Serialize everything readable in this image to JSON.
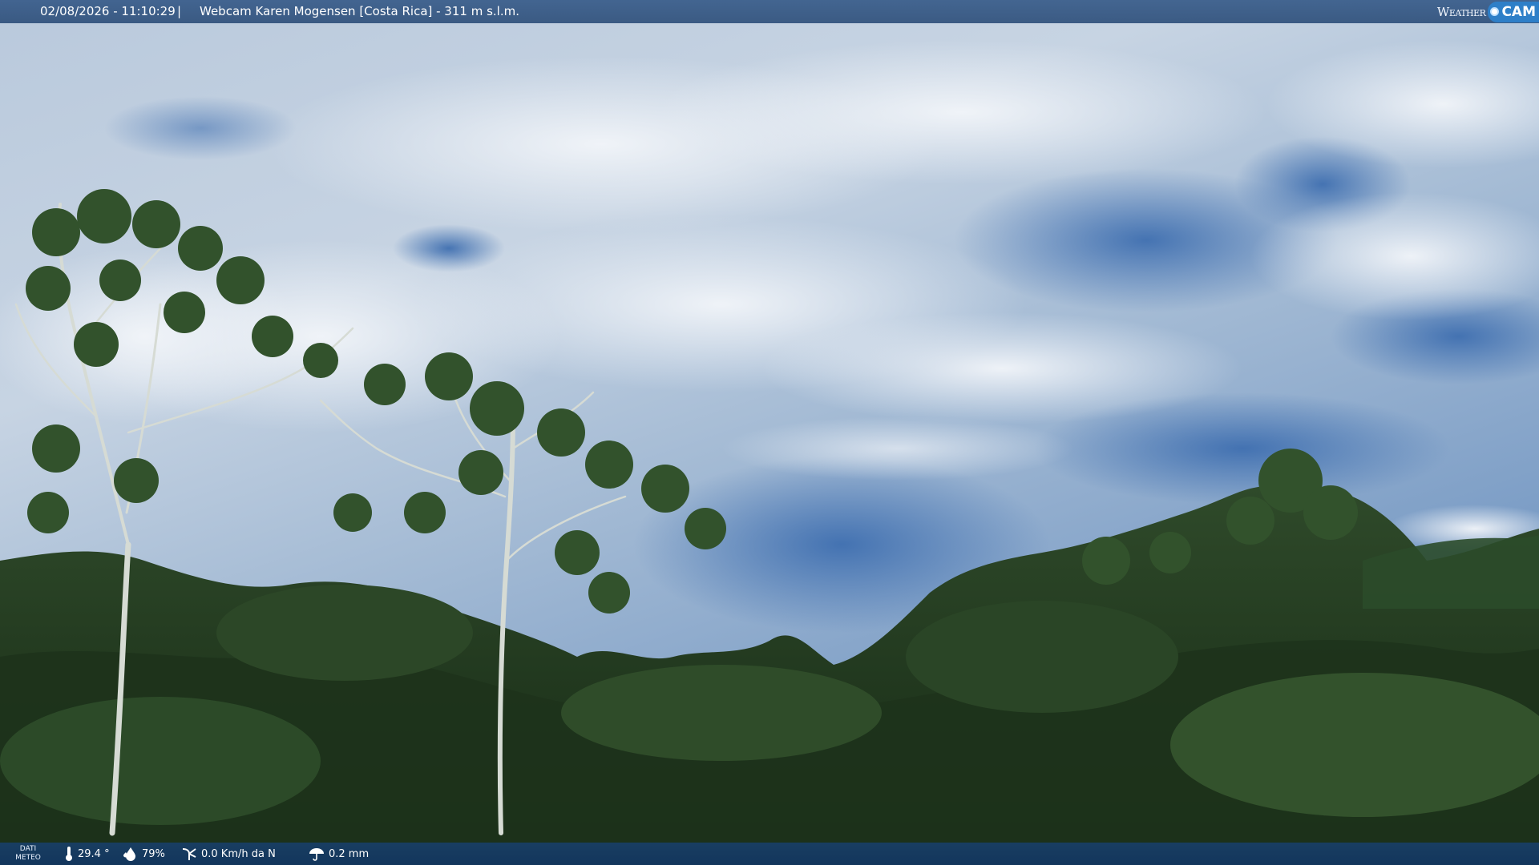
{
  "header": {
    "datetime": "02/08/2026 - 11:10:29",
    "separator": "|",
    "title": "Webcam Karen Mogensen [Costa Rica] - 311 m s.l.m."
  },
  "logo": {
    "weather_text": "Weather",
    "cam_text": "CAM",
    "icon": "camera-lens-icon"
  },
  "footer": {
    "label_line1": "DATI",
    "label_line2": "METEO",
    "temperature": "29.4 °",
    "humidity": "79%",
    "wind": "0.0 Km/h da N",
    "rain": "0.2 mm",
    "icons": {
      "temperature": "thermometer-icon",
      "humidity": "droplet-icon",
      "wind": "wind-icon",
      "rain": "umbrella-icon"
    }
  }
}
